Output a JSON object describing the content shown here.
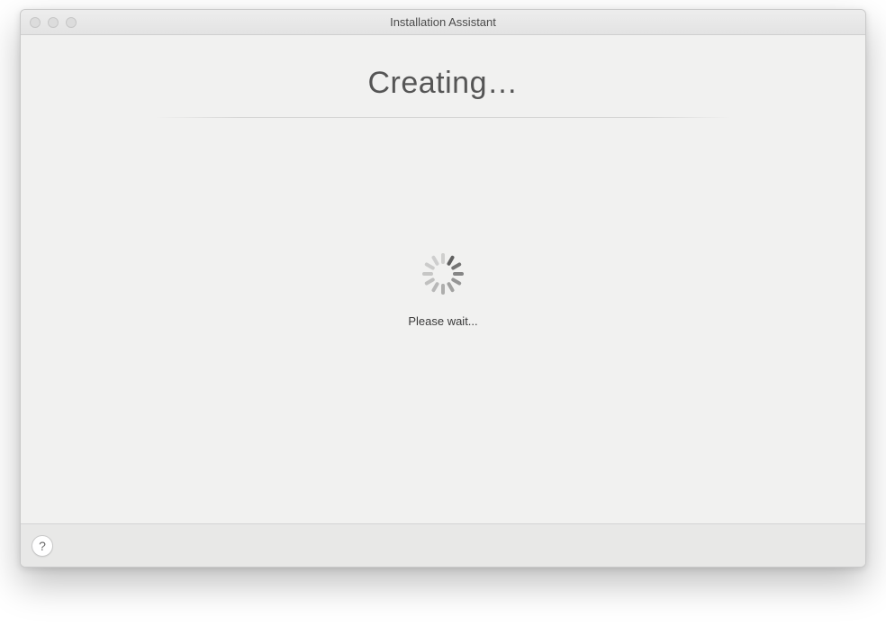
{
  "window": {
    "title": "Installation Assistant"
  },
  "main": {
    "heading": "Creating…",
    "status": "Please wait..."
  },
  "footer": {
    "help_symbol": "?"
  },
  "spinner": {
    "blades": 12
  }
}
